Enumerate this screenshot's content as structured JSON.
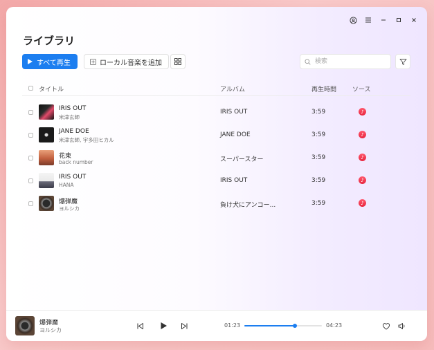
{
  "page": {
    "title": "ライブラリ"
  },
  "toolbar": {
    "play_all_label": "すべて再生",
    "add_local_label": "ローカル音楽を追加",
    "search_placeholder": "検索"
  },
  "table": {
    "columns": {
      "title": "タイトル",
      "album": "アルバム",
      "duration": "再生時間",
      "source": "ソース"
    },
    "rows": [
      {
        "title": "IRIS OUT",
        "artist": "米津玄師",
        "album": "IRIS OUT",
        "duration": "3:59",
        "source": "apple-music-icon"
      },
      {
        "title": "JANE DOE",
        "artist": "米津玄師, 宇多田ヒカル",
        "album": "JANE DOE",
        "duration": "3:59",
        "source": "apple-music-icon"
      },
      {
        "title": "花束",
        "artist": "back number",
        "album": "スーパースター",
        "duration": "3:59",
        "source": "apple-music-icon"
      },
      {
        "title": "IRIS OUT",
        "artist": "HANA",
        "album": "IRIS OUT",
        "duration": "3:59",
        "source": "apple-music-icon"
      },
      {
        "title": "爆弾魔",
        "artist": "ヨルシカ",
        "album": "負け犬にアンコー...",
        "duration": "3:59",
        "source": "apple-music-icon"
      }
    ]
  },
  "player": {
    "title": "爆弾魔",
    "artist": "ヨルシカ",
    "current_time": "01:23",
    "total_time": "04:23",
    "progress": 0.65
  },
  "colors": {
    "accent": "#1c7ef0",
    "source_badge": "#f0374f"
  }
}
